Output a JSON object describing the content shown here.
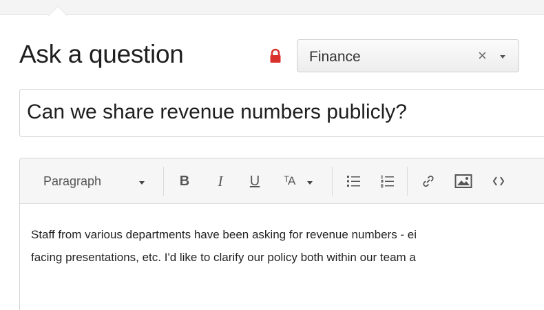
{
  "page": {
    "title": "Ask a question"
  },
  "topic": {
    "selected": "Finance",
    "clear_symbol": "×"
  },
  "question": {
    "title_value": "Can we share revenue numbers publicly?"
  },
  "toolbar": {
    "paragraph_label": "Paragraph",
    "bold_label": "B",
    "italic_label": "I",
    "underline_label": "U",
    "font_label": "ᵀA"
  },
  "editor": {
    "lines": [
      "Staff from various departments have been asking for revenue numbers - ei",
      "facing presentations, etc. I'd like to clarify our policy both within our team a"
    ]
  },
  "icons": {
    "lock": "lock-icon",
    "bulleted_list": "bulleted-list-icon",
    "numbered_list": "numbered-list-icon",
    "link": "link-icon",
    "image": "image-icon",
    "code": "code-icon"
  },
  "colors": {
    "lock": "#d9312b",
    "toolbar_icon": "#555555"
  }
}
